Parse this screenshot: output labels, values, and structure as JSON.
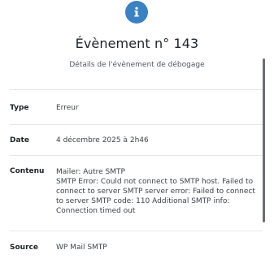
{
  "header": {
    "icon": "info-icon",
    "title": "Évènement n° 143",
    "subtitle": "Détails de l'évènement de débogage"
  },
  "details": [
    {
      "label": "Type",
      "value": "Erreur"
    },
    {
      "label": "Date",
      "value": "4 décembre 2025 à 2h46"
    },
    {
      "label": "Contenu",
      "lines": [
        "Mailer: Autre SMTP",
        "SMTP Error: Could not connect to SMTP host. Failed to connect to server SMTP server error: Failed to connect to server SMTP code: 110 Additional SMTP info: Connection timed out"
      ]
    },
    {
      "label": "Source",
      "value": "WP Mail SMTP"
    }
  ],
  "colors": {
    "accent": "#3b82c4",
    "border": "#e4e6e8",
    "text": "#3c434a"
  }
}
